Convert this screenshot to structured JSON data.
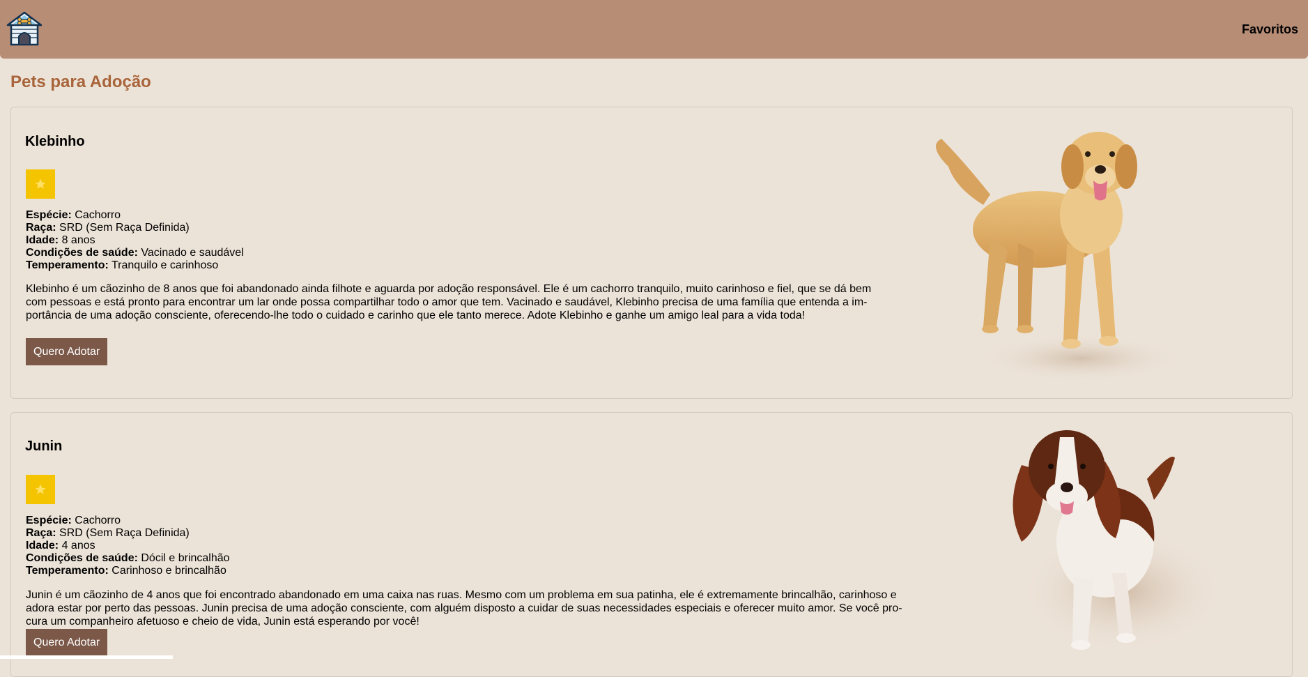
{
  "header": {
    "logo_icon": "doghouse-icon",
    "favorites_label": "Favoritos"
  },
  "page": {
    "title": "Pets para Adoção"
  },
  "labels": {
    "species": "Espécie:",
    "breed": "Raça:",
    "age": "Idade:",
    "health": "Condições de saúde:",
    "temperament": "Temperamento:",
    "adopt_button": "Quero Adotar"
  },
  "colors": {
    "header_bg": "#b78d76",
    "page_bg": "#ece3d8",
    "title": "#a8643a",
    "favorite_button": "#f5c400",
    "adopt_button": "#7b5848"
  },
  "pets": [
    {
      "name": "Klebinho",
      "favorite_icon": "star-icon",
      "species": "Cachorro",
      "breed": "SRD (Sem Raça Definida)",
      "age": "8 anos",
      "health": "Vacinado e saudável",
      "temperament": "Tranquilo e carinhoso",
      "description_lines": [
        "Klebinho é um cãozinho de 8 anos que foi abandonado ainda filhote e aguarda por adoção responsável. Ele é um cachorro tranquilo, muito carinhoso e fiel, que se dá bem",
        "com pessoas e está pronto para encontrar um lar onde possa compartilhar todo o amor que tem. Vacinado e saudável, Klebinho precisa de uma família que entenda a im-",
        "portância de uma adoção consciente, oferecendo-lhe todo o cuidado e carinho que ele tanto merece. Adote Klebinho e ganhe um amigo leal para a vida toda!"
      ],
      "image_icon": "golden-retriever-photo"
    },
    {
      "name": "Junin",
      "favorite_icon": "star-icon",
      "species": "Cachorro",
      "breed": "SRD (Sem Raça Definida)",
      "age": "4 anos",
      "health": "Dócil e brincalhão",
      "temperament": "Carinhoso e brincalhão",
      "description_lines": [
        "Junin é um cãozinho de 4 anos que foi encontrado abandonado em uma caixa nas ruas. Mesmo com um problema em sua patinha, ele é extremamente brincalhão, carinhoso e",
        "adora estar por perto das pessoas. Junin precisa de uma adoção consciente, com alguém disposto a cuidar de suas necessidades especiais e oferecer muito amor. Se você pro-",
        "cura um companheiro afetuoso e cheio de vida, Junin está esperando por você!"
      ],
      "image_icon": "spaniel-photo"
    }
  ]
}
